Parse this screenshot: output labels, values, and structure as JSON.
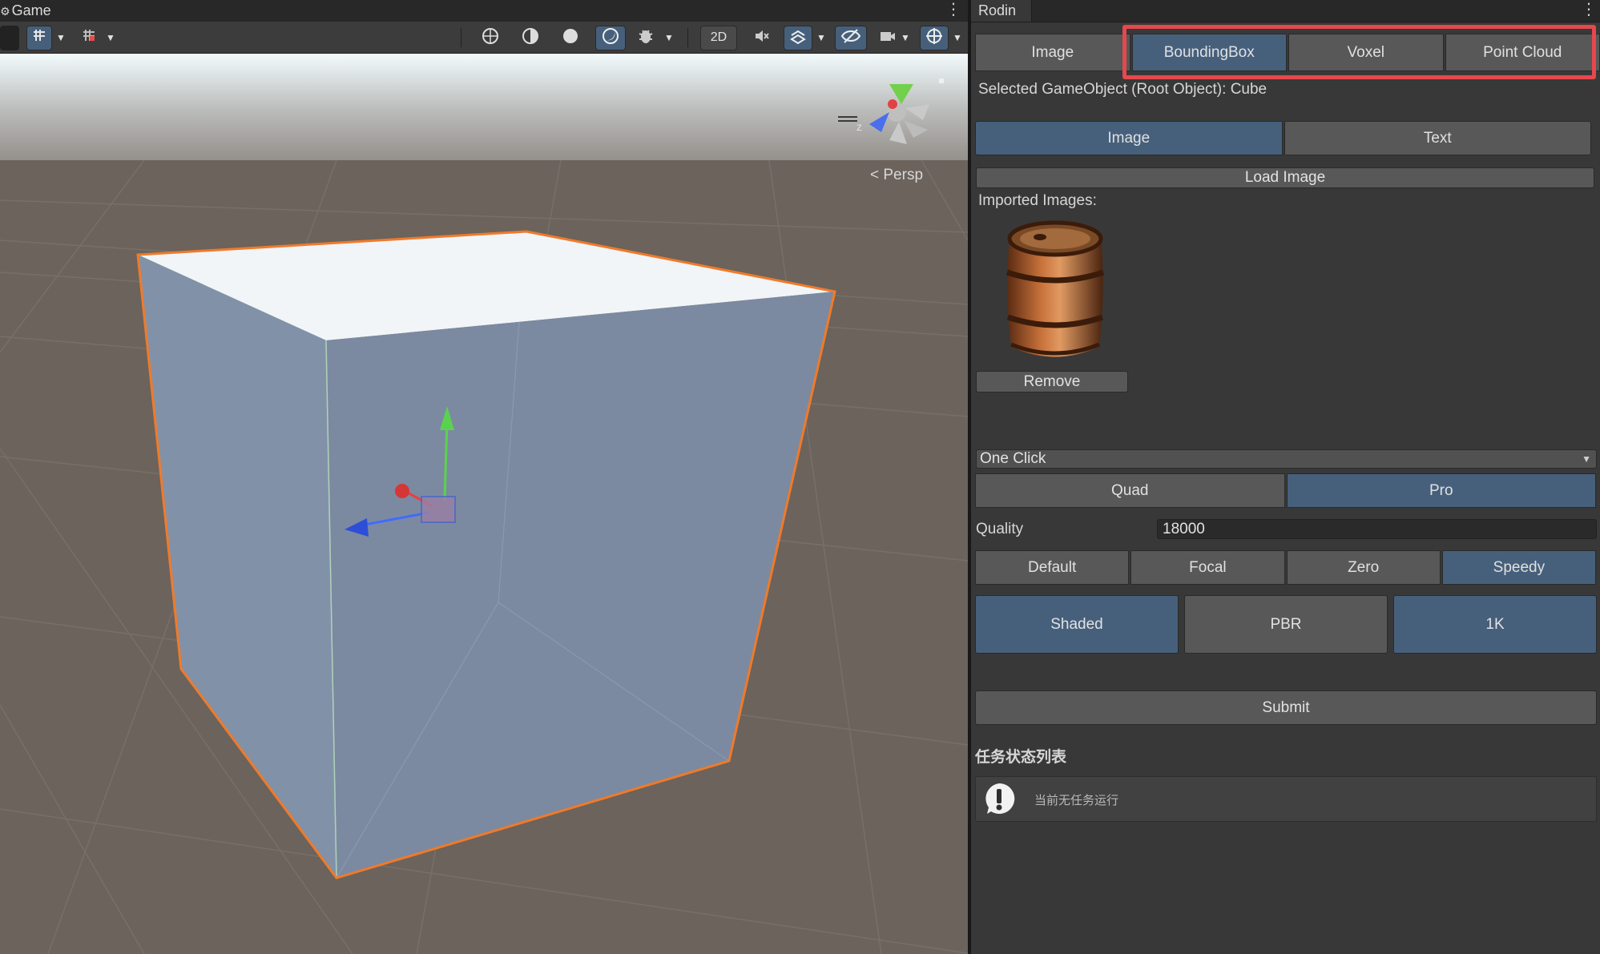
{
  "scene": {
    "tab_title": "Game",
    "kebab": "⋮",
    "camera_mode": "< Persp",
    "toolbar_2d": "2D"
  },
  "panel": {
    "tab_title": "Rodin",
    "kebab": "⋮",
    "mode_tabs": [
      {
        "label": "Image",
        "active": false
      },
      {
        "label": "BoundingBox",
        "active": true
      },
      {
        "label": "Voxel",
        "active": false
      },
      {
        "label": "Point Cloud",
        "active": false
      }
    ],
    "selected_object_text": "Selected GameObject (Root Object): Cube",
    "input_tabs": [
      {
        "label": "Image",
        "active": true
      },
      {
        "label": "Text",
        "active": false
      }
    ],
    "load_image_label": "Load Image",
    "imported_images_label": "Imported Images:",
    "remove_label": "Remove",
    "generation_dropdown": "One Click",
    "tier_tabs": [
      {
        "label": "Quad",
        "active": false
      },
      {
        "label": "Pro",
        "active": true
      }
    ],
    "quality_label": "Quality",
    "quality_value": "18000",
    "preset_tabs": [
      {
        "label": "Default",
        "active": false
      },
      {
        "label": "Focal",
        "active": false
      },
      {
        "label": "Zero",
        "active": false
      },
      {
        "label": "Speedy",
        "active": true
      }
    ],
    "material_buttons": [
      {
        "label": "Shaded",
        "active": true
      },
      {
        "label": "PBR",
        "active": false
      },
      {
        "label": "1K",
        "active": true
      }
    ],
    "submit_label": "Submit",
    "task_list_title": "任务状态列表",
    "task_status_text": "当前无任务运行"
  },
  "colors": {
    "accent_active": "#46607c",
    "highlight_border": "#e5484d",
    "selection_outline": "#f07a2a"
  }
}
